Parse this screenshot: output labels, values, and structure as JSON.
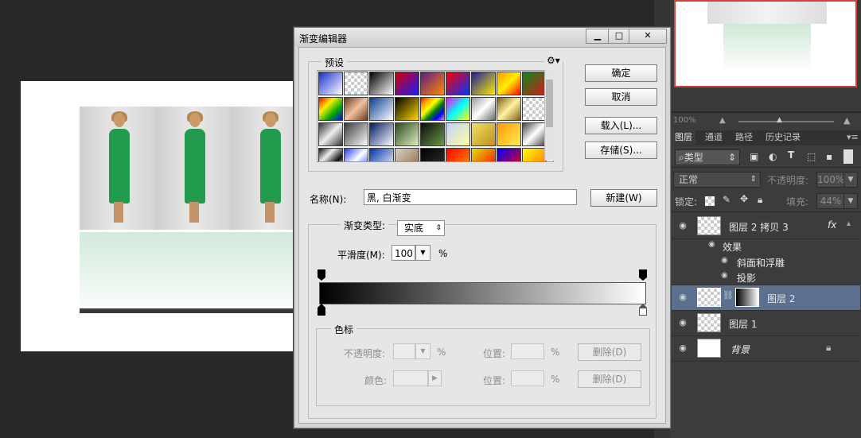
{
  "dialog": {
    "title": "渐变编辑器",
    "presets_label": "预设",
    "gear_icon": "gear-icon",
    "buttons": {
      "ok": "确定",
      "cancel": "取消",
      "load": "载入(L)...",
      "save": "存储(S)...",
      "new": "新建(W)",
      "delete1": "删除(D)",
      "delete2": "删除(D)"
    },
    "name_label": "名称(N):",
    "name_value": "黑, 白渐变",
    "gradient_type_label": "渐变类型:",
    "gradient_type_value": "实底",
    "smoothness_label": "平滑度(M):",
    "smoothness_value": "100",
    "percent": "%",
    "stops_label": "色标",
    "opacity_label": "不透明度:",
    "color_label": "颜色:",
    "location_label": "位置:",
    "window_buttons": {
      "minimize": "▁",
      "maximize": "□",
      "close": "✕"
    }
  },
  "layers_panel": {
    "zoom": "100%",
    "tabs": [
      "图层",
      "通道",
      "路径",
      "历史记录"
    ],
    "filter_kind": "类型",
    "blend_mode": "正常",
    "opacity_label": "不透明度:",
    "opacity_value": "100%",
    "lock_label": "锁定:",
    "fill_label": "填充:",
    "fill_value": "44%",
    "layers": [
      {
        "name": "图层 2 拷贝 3",
        "fx": "fx"
      },
      {
        "name": "效果"
      },
      {
        "name": "斜面和浮雕"
      },
      {
        "name": "投影"
      },
      {
        "name": "图层 2"
      },
      {
        "name": "图层 1"
      },
      {
        "name": "背景"
      }
    ]
  },
  "colors": {
    "selected_layer": "#5b6f8e",
    "dialog_bg": "#d6d6d6"
  }
}
